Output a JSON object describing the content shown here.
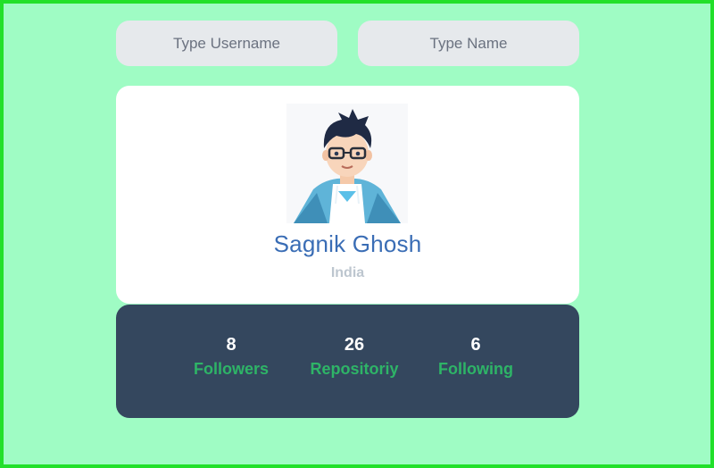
{
  "search": {
    "username_placeholder": "Type Username",
    "name_placeholder": "Type Name"
  },
  "profile": {
    "name": "Sagnik Ghosh",
    "location": "India",
    "avatar_icon": "user-avatar-illustration"
  },
  "stats": [
    {
      "value": "8",
      "label": "Followers"
    },
    {
      "value": "26",
      "label": "Repositoriy"
    },
    {
      "value": "6",
      "label": "Following"
    }
  ],
  "colors": {
    "page_background": "#9ffcc4",
    "page_border": "#22e02a",
    "input_background": "#e6e9ec",
    "name_color": "#3a6db5",
    "location_color": "#bdc6cf",
    "stats_background": "#34475e",
    "stat_label_color": "#2eb467"
  }
}
